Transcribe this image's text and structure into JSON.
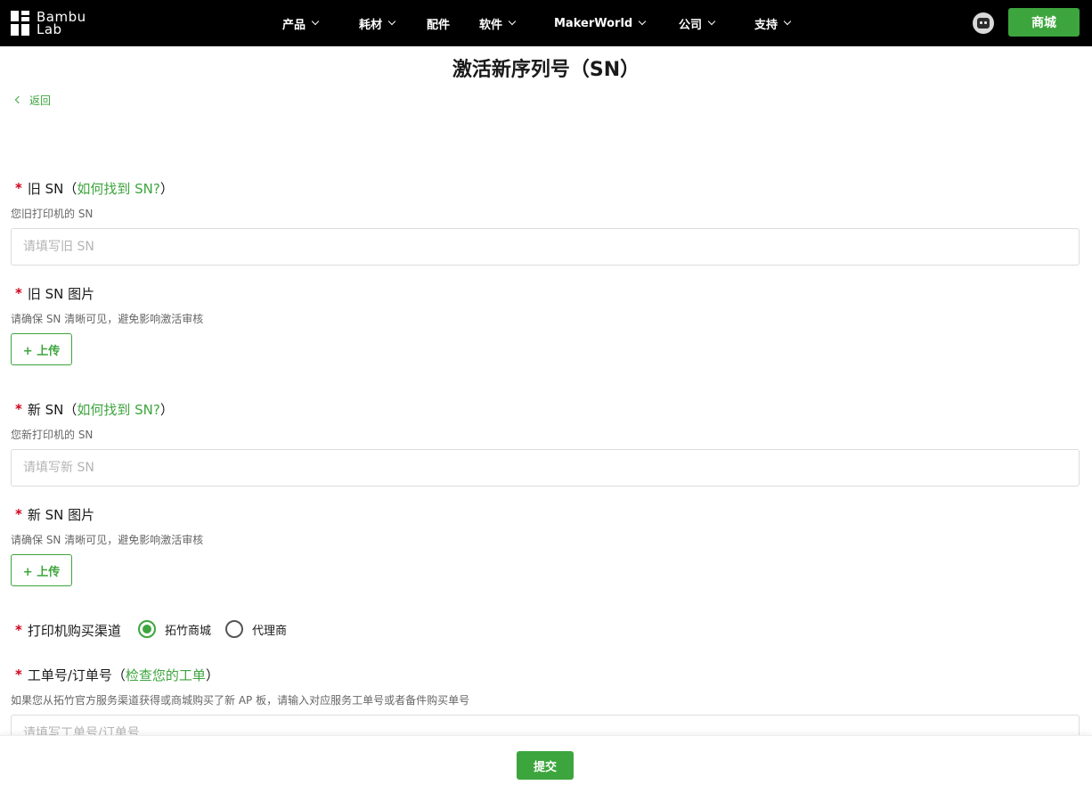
{
  "nav": {
    "logo_line1": "Bambu",
    "logo_line2": "Lab",
    "items": [
      {
        "label": "产品",
        "has_dropdown": true
      },
      {
        "label": "耗材",
        "has_dropdown": true
      },
      {
        "label": "配件",
        "has_dropdown": false
      },
      {
        "label": "软件",
        "has_dropdown": true
      },
      {
        "label": "MakerWorld",
        "has_dropdown": true
      },
      {
        "label": "公司",
        "has_dropdown": true
      },
      {
        "label": "支持",
        "has_dropdown": true
      }
    ],
    "shop_label": "商城",
    "avatar_icon": "user-avatar-icon"
  },
  "page": {
    "title": "激活新序列号（SN）",
    "back_label": "返回"
  },
  "form": {
    "old_sn": {
      "required": "*",
      "label": "旧 SN（",
      "link": "如何找到 SN?",
      "label_end": "）",
      "hint": "您旧打印机的 SN",
      "placeholder": "请填写旧 SN"
    },
    "old_sn_image": {
      "required": "*",
      "label": "旧 SN 图片",
      "hint": "请确保 SN 清晰可见，避免影响激活审核",
      "upload_label": "+ 上传"
    },
    "new_sn": {
      "required": "*",
      "label": "新 SN（",
      "link": "如何找到 SN?",
      "label_end": "）",
      "hint": "您新打印机的 SN",
      "placeholder": "请填写新 SN"
    },
    "new_sn_image": {
      "required": "*",
      "label": "新 SN 图片",
      "hint": "请确保 SN 清晰可见，避免影响激活审核",
      "upload_label": "+ 上传"
    },
    "channel": {
      "required": "*",
      "label": "打印机购买渠道",
      "options": [
        {
          "label": "拓竹商城",
          "checked": true
        },
        {
          "label": "代理商",
          "checked": false
        }
      ]
    },
    "order": {
      "required": "*",
      "label": "工单号/订单号（",
      "link": "检查您的工单",
      "label_end": "）",
      "hint": "如果您从拓竹官方服务渠道获得或商城购买了新 AP 板，请输入对应服务工单号或者备件购买单号",
      "placeholder": "请填写工单号/订单号"
    }
  },
  "footer": {
    "submit_label": "提交"
  },
  "colors": {
    "accent": "#3da53d",
    "nav_bg": "#000000",
    "required": "#d0021b"
  }
}
